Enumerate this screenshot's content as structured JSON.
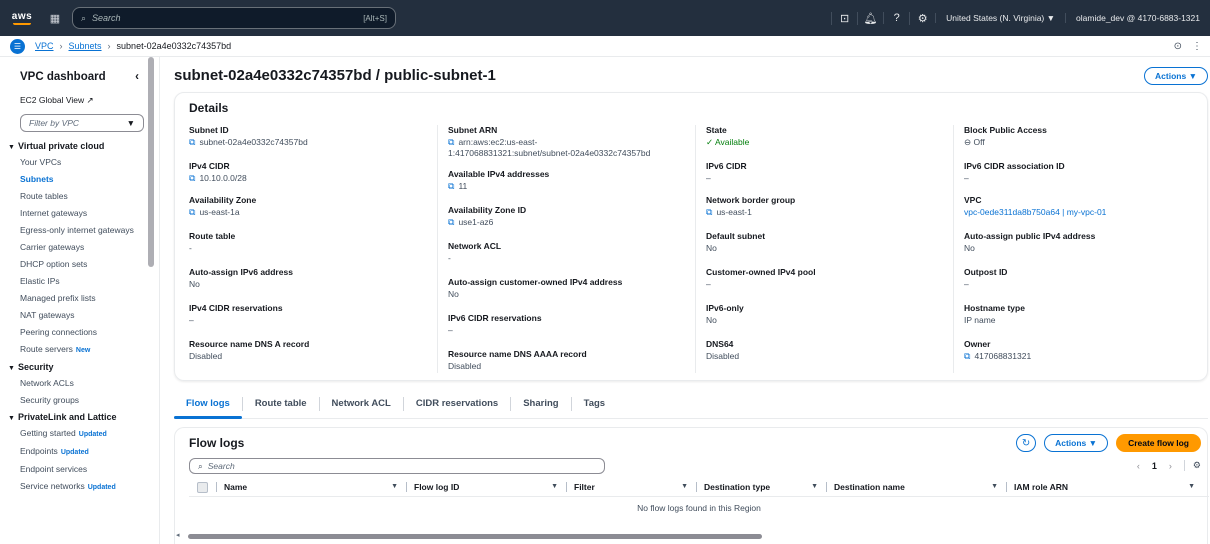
{
  "topbar": {
    "logo": "aws",
    "search_placeholder": "Search",
    "shortcut": "[Alt+S]",
    "region": "United States (N. Virginia) ▼",
    "account": "olamide_dev @ 4170-6883-1321"
  },
  "breadcrumb": {
    "items": [
      "VPC",
      "Subnets"
    ],
    "current": "subnet-02a4e0332c74357bd"
  },
  "sidebar": {
    "title": "VPC dashboard",
    "global_view": "EC2 Global View",
    "filter_placeholder": "Filter by VPC",
    "sections": [
      {
        "title": "Virtual private cloud",
        "items": [
          {
            "label": "Your VPCs"
          },
          {
            "label": "Subnets",
            "active": true
          },
          {
            "label": "Route tables"
          },
          {
            "label": "Internet gateways"
          },
          {
            "label": "Egress-only internet gateways"
          },
          {
            "label": "Carrier gateways"
          },
          {
            "label": "DHCP option sets"
          },
          {
            "label": "Elastic IPs"
          },
          {
            "label": "Managed prefix lists"
          },
          {
            "label": "NAT gateways"
          },
          {
            "label": "Peering connections"
          },
          {
            "label": "Route servers",
            "badge": "New"
          }
        ]
      },
      {
        "title": "Security",
        "items": [
          {
            "label": "Network ACLs"
          },
          {
            "label": "Security groups"
          }
        ]
      },
      {
        "title": "PrivateLink and Lattice",
        "items": [
          {
            "label": "Getting started",
            "badge": "Updated"
          },
          {
            "label": "Endpoints",
            "badge": "Updated"
          },
          {
            "label": "Endpoint services"
          },
          {
            "label": "Service networks",
            "badge": "Updated"
          }
        ]
      }
    ]
  },
  "page": {
    "title": "subnet-02a4e0332c74357bd / public-subnet-1",
    "actions_label": "Actions ▼"
  },
  "details": {
    "heading": "Details",
    "col1": {
      "subnet_id_label": "Subnet ID",
      "subnet_id": "subnet-02a4e0332c74357bd",
      "ipv4_cidr_label": "IPv4 CIDR",
      "ipv4_cidr": "10.10.0.0/28",
      "az_label": "Availability Zone",
      "az": "us-east-1a",
      "route_table_label": "Route table",
      "route_table": "-",
      "auto_ipv6_label": "Auto-assign IPv6 address",
      "auto_ipv6": "No",
      "ipv4_res_label": "IPv4 CIDR reservations",
      "ipv4_res": "–",
      "dns_a_label": "Resource name DNS A record",
      "dns_a": "Disabled"
    },
    "col2": {
      "arn_label": "Subnet ARN",
      "arn_1": "arn:aws:ec2:us-east-",
      "arn_2": "1:417068831321:subnet/subnet-02a4e0332c74357bd",
      "avail_ipv4_label": "Available IPv4 addresses",
      "avail_ipv4": "11",
      "az_id_label": "Availability Zone ID",
      "az_id": "use1-az6",
      "nacl_label": "Network ACL",
      "nacl": "-",
      "auto_cust_label": "Auto-assign customer-owned IPv4 address",
      "auto_cust": "No",
      "ipv6_res_label": "IPv6 CIDR reservations",
      "ipv6_res": "–",
      "dns_aaaa_label": "Resource name DNS AAAA record",
      "dns_aaaa": "Disabled"
    },
    "col3": {
      "state_label": "State",
      "state": "Available",
      "ipv6_cidr_label": "IPv6 CIDR",
      "ipv6_cidr": "–",
      "border_group_label": "Network border group",
      "border_group": "us-east-1",
      "default_subnet_label": "Default subnet",
      "default_subnet": "No",
      "cust_pool_label": "Customer-owned IPv4 pool",
      "cust_pool": "–",
      "ipv6_only_label": "IPv6-only",
      "ipv6_only": "No",
      "dns64_label": "DNS64",
      "dns64": "Disabled"
    },
    "col4": {
      "bpa_label": "Block Public Access",
      "bpa": "Off",
      "ipv6_assoc_label": "IPv6 CIDR association ID",
      "ipv6_assoc": "–",
      "vpc_label": "VPC",
      "vpc": "vpc-0ede311da8b750a64 | my-vpc-01",
      "auto_pub_label": "Auto-assign public IPv4 address",
      "auto_pub": "No",
      "outpost_label": "Outpost ID",
      "outpost": "–",
      "hostname_label": "Hostname type",
      "hostname": "IP name",
      "owner_label": "Owner",
      "owner": "417068831321"
    }
  },
  "tabs": [
    "Flow logs",
    "Route table",
    "Network ACL",
    "CIDR reservations",
    "Sharing",
    "Tags"
  ],
  "flow_logs": {
    "title": "Flow logs",
    "actions_label": "Actions ▼",
    "create_label": "Create flow log",
    "search_placeholder": "Search",
    "page_number": "1",
    "columns": [
      "Name",
      "Flow log ID",
      "Filter",
      "Destination type",
      "Destination name",
      "IAM role ARN"
    ],
    "empty_message": "No flow logs found in this Region"
  },
  "colors": {
    "topbar_bg": "#232f3e",
    "link": "#0972d3",
    "primary_button": "#ff9900",
    "success": "#037f0c"
  }
}
